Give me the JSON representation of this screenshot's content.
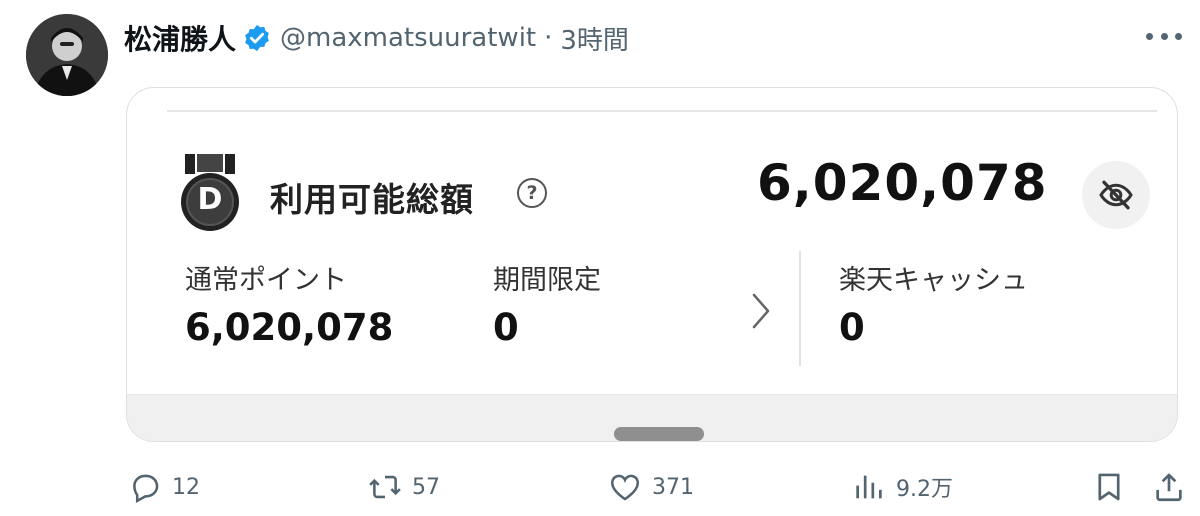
{
  "author": {
    "name": "松浦勝人",
    "handle": "@maxmatsuuratwit",
    "separator": "·",
    "time": "3時間"
  },
  "card": {
    "medal_letter": "D",
    "available_label": "利用可能総額",
    "help_symbol": "?",
    "total_value": "6,020,078",
    "columns": [
      {
        "label": "通常ポイント",
        "value": "6,020,078"
      },
      {
        "label": "期間限定",
        "value": "0"
      },
      {
        "label": "楽天キャッシュ",
        "value": "0"
      }
    ]
  },
  "actions": {
    "replies": "12",
    "retweets": "57",
    "likes": "371",
    "views": "9.2万"
  },
  "colors": {
    "verified": "#1d9bf0",
    "secondary_text": "#536471",
    "medal_dark": "#222222",
    "scroll_handle": "#8f8f8f"
  },
  "icons": [
    "more-icon",
    "verified-badge-icon",
    "medal-icon",
    "help-icon",
    "eye-off-icon",
    "chevron-right-icon",
    "reply-icon",
    "retweet-icon",
    "like-icon",
    "views-icon",
    "bookmark-icon",
    "share-icon"
  ]
}
